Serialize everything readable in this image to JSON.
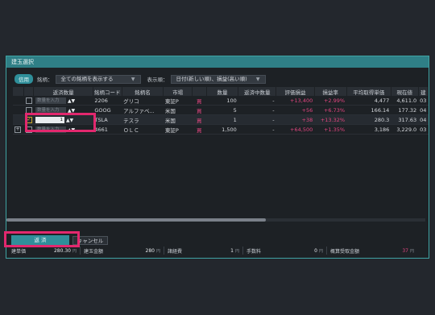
{
  "dialog": {
    "title": "建玉選択",
    "filter": {
      "badge": "信用",
      "stock_label": "銘柄：",
      "stock_value": "全ての銘柄を表示する",
      "order_label": "表示順：",
      "order_value": "日付(新しい順)、損益(高い順)"
    },
    "columns": [
      "返済数量",
      "銘柄コード",
      "銘柄名",
      "市場",
      "",
      "数量",
      "返済中数量",
      "評価損益",
      "損益率",
      "平均取得単価",
      "現在値",
      "建"
    ],
    "rows": [
      {
        "qty_placeholder": "数量を入力",
        "code": "2206",
        "name": "グリコ",
        "market": "東証P",
        "side": "買",
        "qty": "100",
        "pending": "-",
        "pl": "+13,400",
        "rate": "+2.99",
        "avg": "4,477",
        "price": "4,611.0",
        "extra": "03",
        "checked": false
      },
      {
        "qty_placeholder": "数量を入力",
        "code": "GOOG",
        "name": "アルファベ...",
        "market": "米国",
        "side": "買",
        "qty": "5",
        "pending": "-",
        "pl": "+56",
        "rate": "+6.73",
        "avg": "166.14",
        "price": "177.32",
        "extra": "04",
        "checked": false
      },
      {
        "qty_value": "1",
        "code": "TSLA",
        "name": "テスラ",
        "market": "米国",
        "side": "買",
        "qty": "1",
        "pending": "-",
        "pl": "+38",
        "rate": "+13.32",
        "avg": "280.3",
        "price": "317.63",
        "extra": "04",
        "checked": true
      },
      {
        "qty_placeholder": "数量を入力",
        "code": "4661",
        "name": "ＯＬＣ",
        "market": "東証P",
        "side": "買",
        "qty": "1,500",
        "pending": "-",
        "pl": "+64,500",
        "rate": "+1.35",
        "avg": "3,186",
        "price": "3,229.0",
        "extra": "03",
        "checked": false
      }
    ],
    "percent_unit": "%",
    "buttons": {
      "return": "返 済",
      "cancel": "キャンセル"
    },
    "summary": [
      {
        "label": "建単価",
        "value": "280.30",
        "unit": "円"
      },
      {
        "label": "建玉金額",
        "value": "280",
        "unit": "円"
      },
      {
        "label": "諸経費",
        "value": "1",
        "unit": "円"
      },
      {
        "label": "手数料",
        "value": "0",
        "unit": "円"
      },
      {
        "label": "概算受取金額",
        "value": "37",
        "unit": "円",
        "highlight": true
      }
    ],
    "scroll_position": 0.62
  },
  "colors": {
    "accent": "#2f8f9a",
    "highlight": "#e2286e",
    "profit": "#e0457f"
  }
}
